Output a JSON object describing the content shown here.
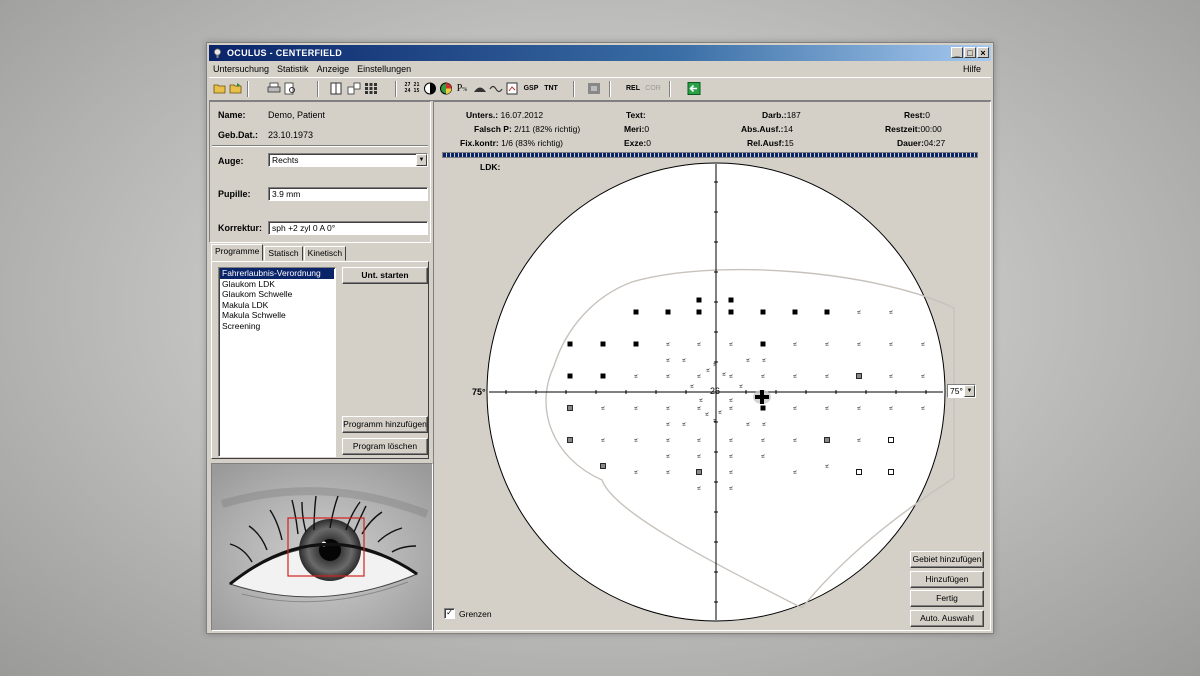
{
  "window": {
    "title": "OCULUS - CENTERFIELD",
    "controls": [
      "_",
      "□",
      "×"
    ]
  },
  "menu": {
    "items": [
      "Untersuchung",
      "Statistik",
      "Anzeige",
      "Einstellungen"
    ],
    "help": "Hilfe"
  },
  "toolbar": {
    "icons": [
      "open-folder-icon",
      "save-folder-icon",
      "print-icon",
      "print-preview-icon",
      "single-view-icon",
      "multi-view-icon",
      "grid-view-icon",
      "numeric-view-icon",
      "greyscale-icon",
      "color-map-icon",
      "probability-icon",
      "hill-icon",
      "curve-icon",
      "report-icon",
      "gsp-icon",
      "tnt-icon",
      "stack-icon",
      "rel-icon",
      "cor-icon",
      "exit-icon"
    ],
    "texts": {
      "nums_top": "27 21",
      "nums_bot": "24 15",
      "p": "P",
      "gsp": "GSP",
      "tnt": "TNT",
      "rel": "REL",
      "cor": "COR"
    }
  },
  "patient": {
    "name_label": "Name:",
    "name": "Demo, Patient",
    "dob_label": "Geb.Dat.:",
    "dob": "23.10.1973",
    "eye_label": "Auge:",
    "eye": "Rechts",
    "pupil_label": "Pupille:",
    "pupil": "3.9 mm",
    "correction_label": "Korrektur:",
    "correction": "sph +2  zyl 0  A 0°"
  },
  "tabs": [
    "Programme",
    "Statisch",
    "Kinetisch"
  ],
  "programs": {
    "items": [
      "Fahrerlaubnis-Verordnung",
      "Glaukom LDK",
      "Glaukom Schwelle",
      "Makula LDK",
      "Makula Schwelle",
      "Screening"
    ],
    "selected_index": 0,
    "start_button": "Unt. starten",
    "add_button": "Programm hinzufügen",
    "delete_button": "Program löschen"
  },
  "stats": {
    "unters_label": "Unters.:",
    "unters": "16.07.2012",
    "falsch_label": "Falsch P:",
    "falsch": "2/11 (82% richtig)",
    "fix_label": "Fix.kontr:",
    "fix": "1/6 (83% richtig)",
    "text_label": "Text:",
    "text": "",
    "meri_label": "Meri:",
    "meri": "0",
    "exze_label": "Exze:",
    "exze": "0",
    "darb_label": "Darb.:",
    "darb": "187",
    "abs_label": "Abs.Ausf.:",
    "abs": "14",
    "rel_label": "Rel.Ausf:",
    "rel": "15",
    "rest_label": "Rest:",
    "rest": "0",
    "restzeit_label": "Restzeit:",
    "restzeit": "00:00",
    "dauer_label": "Dauer:",
    "dauer": "04:27"
  },
  "plot": {
    "mode_label": "LDK:",
    "left_scale": "75°",
    "center_value": "26",
    "range_select": "75°",
    "grenzen_label": "Grenzen",
    "grenzen_checked": true
  },
  "actions": {
    "add_area": "Gebiet hinzufügen",
    "add": "Hinzufügen",
    "done": "Fertig",
    "auto_select": "Auto. Auswahl"
  }
}
